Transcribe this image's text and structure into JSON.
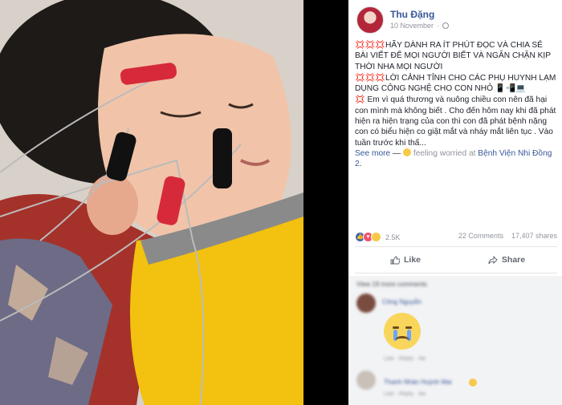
{
  "post": {
    "author": "Thu Đặng",
    "date": "10 November",
    "paragraph1": "💢💢💢HÃY DÀNH RA ÍT PHÚT ĐỌC VÀ CHIA SẺ BÀI VIẾT ĐỂ MỌI NGƯỜI BIẾT VÀ NGĂN CHẶN KỊP THỜI NHA MỌI NGƯỜI",
    "paragraph2": "💢💢💢LỜI CẢNH TỈNH CHO CÁC PHỤ HUYNH LẠM DỤNG CÔNG NGHỆ CHO CON NHỎ 📱📲💻",
    "paragraph3": "💢 Em vì quá thương và nuông chiều con nên đã hại con mình mà không biết . Cho đến hôm nay khi đã phát hiện ra hiện trạng của con thì con đã phát bệnh nặng con có biểu hiện co giật mắt và nháy mắt liên tục . Vào tuần trước khi thấ...",
    "see_more": "See more",
    "feeling_sep": " — ",
    "feeling_text": " feeling worried at ",
    "feeling_place": "Bệnh Viện Nhi Đồng 2",
    "feeling_end": "."
  },
  "stats": {
    "reactions_count": "2.5K",
    "comments": "22 Comments",
    "shares": "17,407 shares"
  },
  "actions": {
    "like": "Like",
    "share": "Share"
  },
  "comments": {
    "view_previous": "View 19 more comments",
    "items": [
      {
        "name": "Công Nguyễn",
        "meta": "Like · Reply · 4w"
      },
      {
        "name": "Thanh Nhàn Huỳnh Mai",
        "meta": "Like · Reply · 4w"
      }
    ]
  },
  "colors": {
    "link": "#385898",
    "muted": "#90949c",
    "like_blue": "#4267b2"
  }
}
